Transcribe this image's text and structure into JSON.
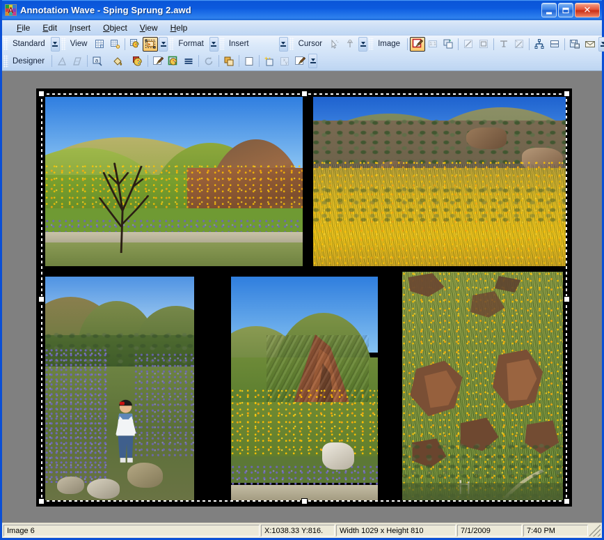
{
  "window": {
    "title": "Annotation Wave - Sping Sprung 2.awd",
    "app_icon": "annotation-wave-icon",
    "minimize_label": "_",
    "maximize_label": "□",
    "close_label": "✕"
  },
  "menu": {
    "items": [
      {
        "id": "file",
        "accel": "F",
        "rest": "ile"
      },
      {
        "id": "edit",
        "accel": "E",
        "rest": "dit"
      },
      {
        "id": "insert",
        "accel": "I",
        "rest": "nsert"
      },
      {
        "id": "object",
        "accel": "O",
        "rest": "bject"
      },
      {
        "id": "view",
        "accel": "V",
        "rest": "iew"
      },
      {
        "id": "help",
        "accel": "H",
        "rest": "elp"
      }
    ]
  },
  "toolbars": {
    "row1": [
      {
        "name": "standard",
        "label": "Standard",
        "buttons": []
      },
      {
        "name": "view",
        "label": "View",
        "buttons": [
          {
            "icon": "thumbnail-grid-icon",
            "state": "normal"
          },
          {
            "icon": "thumbnail-page-icon",
            "state": "normal"
          },
          {
            "icon": "palette-window-icon",
            "state": "normal"
          },
          {
            "icon": "selection-frame-icon",
            "state": "active"
          }
        ]
      },
      {
        "name": "format",
        "label": "Format",
        "buttons": []
      },
      {
        "name": "insert",
        "label": "Insert",
        "buttons": []
      },
      {
        "name": "cursor",
        "label": "Cursor",
        "buttons": [
          {
            "icon": "pointer-path-icon",
            "state": "dim"
          },
          {
            "icon": "anchor-point-icon",
            "state": "dim"
          }
        ]
      },
      {
        "name": "image",
        "label": "Image",
        "buttons": [
          {
            "icon": "paintbrush-edit-icon",
            "state": "active"
          },
          {
            "icon": "actual-size-icon",
            "state": "dim"
          },
          {
            "icon": "duplicate-layer-icon",
            "state": "normal"
          },
          {
            "icon": "diagonal-line-icon",
            "state": "dim"
          },
          {
            "icon": "rectangle-shape-icon",
            "state": "dim"
          },
          {
            "icon": "text-tool-icon",
            "state": "dim"
          },
          {
            "icon": "magic-wand-icon",
            "state": "dim"
          },
          {
            "icon": "align-distribute-icon",
            "state": "normal"
          },
          {
            "icon": "split-pane-icon",
            "state": "normal"
          },
          {
            "icon": "save-image-icon",
            "state": "normal"
          },
          {
            "icon": "mail-send-icon",
            "state": "normal"
          }
        ]
      }
    ],
    "row2": [
      {
        "name": "designer",
        "label": "Designer",
        "buttons": [
          {
            "icon": "perspective-icon",
            "state": "dim"
          },
          {
            "icon": "skew-icon",
            "state": "dim"
          },
          {
            "icon": "zoom-magnifier-icon",
            "state": "normal"
          },
          {
            "icon": "paint-bucket-icon",
            "state": "normal"
          },
          {
            "icon": "color-palette-icon",
            "state": "normal"
          },
          {
            "icon": "paintbrush-icon",
            "state": "normal"
          },
          {
            "icon": "color-picker-icon",
            "state": "normal"
          },
          {
            "icon": "lines-icon",
            "state": "normal"
          },
          {
            "icon": "rotate-icon",
            "state": "dim"
          },
          {
            "icon": "copy-layer-icon",
            "state": "normal"
          },
          {
            "icon": "blank-page-icon",
            "state": "normal"
          },
          {
            "icon": "effects-sparkle-icon",
            "state": "normal"
          },
          {
            "icon": "resize-xy-icon",
            "state": "dim"
          },
          {
            "icon": "brush-edit-icon",
            "state": "normal"
          }
        ]
      }
    ],
    "overflow_icon": "toolbar-overflow-chevron"
  },
  "canvas": {
    "document_name": "photo-collage-document",
    "selected": true,
    "photos": [
      {
        "id": "photo-1",
        "caption": "hillside-with-bare-tree-and-lupine"
      },
      {
        "id": "photo-2",
        "caption": "rocky-slope-with-goldfields"
      },
      {
        "id": "photo-3",
        "caption": "child-in-lupine-field"
      },
      {
        "id": "photo-4",
        "caption": "ridge-with-orange-rock"
      },
      {
        "id": "photo-5",
        "caption": "steep-wildflower-canyon"
      }
    ]
  },
  "statusbar": {
    "object_name": "Image 6",
    "coordinates": "X:1038.33  Y:816.",
    "dimensions": "Width 1029 x Height 810",
    "date": "7/1/2009",
    "time": "7:40 PM",
    "resize_grip": "resize-grip-icon"
  },
  "colors": {
    "titlebar_blue": "#0a55d8",
    "toolbar_blue": "#cfe1f7",
    "canvas_gray": "#808080",
    "document_black": "#000000",
    "statusbar": "#ece9d8",
    "active_tool": "#ffc96a"
  }
}
